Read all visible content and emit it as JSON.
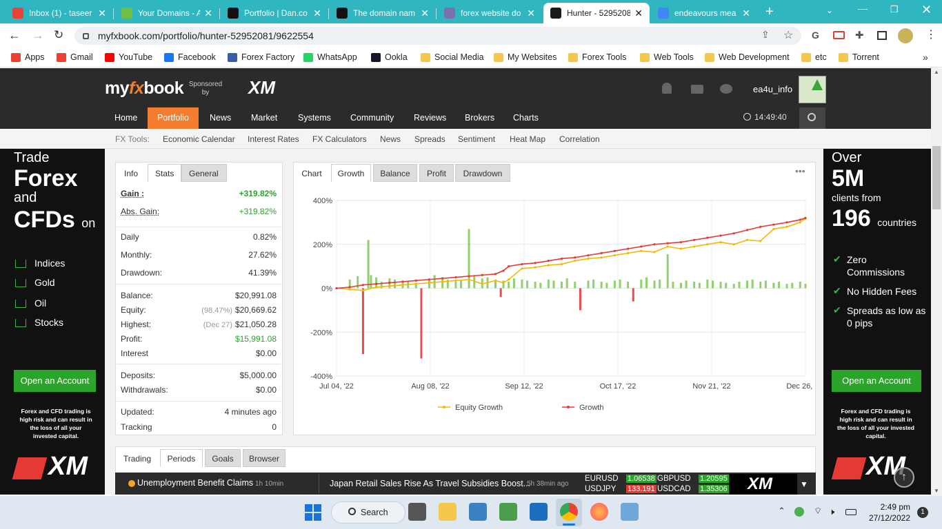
{
  "browser": {
    "tabs": [
      {
        "label": "Inbox (1) - taseer",
        "icon": "gmail-icon",
        "color": "#ea4335"
      },
      {
        "label": "Your Domains - A",
        "icon": "domains-icon",
        "color": "#6fbf44"
      },
      {
        "label": "Portfolio | Dan.co",
        "icon": "dan-icon",
        "color": "#111111"
      },
      {
        "label": "The domain nam",
        "icon": "dan-icon",
        "color": "#111111"
      },
      {
        "label": "forex website do",
        "icon": "page-icon",
        "color": "#7a6fb0"
      },
      {
        "label": "Hunter - 5295208",
        "icon": "fx-icon",
        "color": "#1b1b1b"
      },
      {
        "label": "endeavours mea",
        "icon": "google-icon",
        "color": "#4285f4"
      }
    ],
    "url": "myfxbook.com/portfolio/hunter-52952081/9622554",
    "bookmarks": [
      {
        "label": "Apps",
        "color": "#e94235"
      },
      {
        "label": "Gmail",
        "color": "#ea4335"
      },
      {
        "label": "YouTube",
        "color": "#ff0000"
      },
      {
        "label": "Facebook",
        "color": "#1877f2"
      },
      {
        "label": "Forex Factory",
        "color": "#3a5ca8"
      },
      {
        "label": "WhatsApp",
        "color": "#25d366"
      },
      {
        "label": "Ookla",
        "color": "#141526"
      },
      {
        "label": "Social Media",
        "color": "#f4c84a"
      },
      {
        "label": "My Websites",
        "color": "#f4c84a"
      },
      {
        "label": "Forex Tools",
        "color": "#f4c84a"
      },
      {
        "label": "Web Tools",
        "color": "#f4c84a"
      },
      {
        "label": "Web Development",
        "color": "#f4c84a"
      },
      {
        "label": "etc",
        "color": "#f4c84a"
      },
      {
        "label": "Torrent",
        "color": "#f4c84a"
      }
    ],
    "more": "»"
  },
  "site": {
    "logo_a": "my",
    "logo_b": "fx",
    "logo_c": "book",
    "sponsored": "Sponsored by",
    "sponsor": "XM",
    "username": "ea4u_info",
    "nav": [
      "Home",
      "Portfolio",
      "News",
      "Market",
      "Systems",
      "Community",
      "Reviews",
      "Brokers",
      "Charts"
    ],
    "time": "14:49:40",
    "subnav_label": "FX Tools:",
    "subnav": [
      "Economic Calendar",
      "Interest Rates",
      "FX Calculators",
      "News",
      "Spreads",
      "Sentiment",
      "Heat Map",
      "Correlation"
    ]
  },
  "ad_left": {
    "l1": "Trade",
    "l2": "Forex",
    "l3": "and",
    "l4": "CFDs",
    "l5": "on",
    "items": [
      "Indices",
      "Gold",
      "Oil",
      "Stocks"
    ],
    "cta": "Open an Account",
    "disclaimer": "Forex and CFD trading is high risk and can result in the loss of all your invested capital.",
    "brand": "XM"
  },
  "ad_right": {
    "l1": "Over",
    "l2": "5M",
    "l3": "clients from",
    "l4": "196",
    "l5": "countries",
    "items": [
      "Zero Commissions",
      "No Hidden Fees",
      "Spreads as low as 0 pips"
    ],
    "cta": "Open an Account",
    "disclaimer": "Forex and CFD trading is high risk and can result in the loss of all your invested capital.",
    "brand": "XM"
  },
  "stats": {
    "tabs": [
      "Info",
      "Stats",
      "General"
    ],
    "rows": [
      {
        "k": "Gain :",
        "v": "+319.82%",
        "pre": ""
      },
      {
        "k": "Abs. Gain:",
        "v": "+319.82%",
        "pre": ""
      },
      {
        "k": "Daily",
        "v": "0.82%",
        "pre": ""
      },
      {
        "k": "Monthly:",
        "v": "27.62%",
        "pre": ""
      },
      {
        "k": "Drawdown:",
        "v": "41.39%",
        "pre": ""
      },
      {
        "k": "Balance:",
        "v": "$20,991.08",
        "pre": ""
      },
      {
        "k": "Equity:",
        "v": "$20,669.62",
        "pre": "(98.47%)"
      },
      {
        "k": "Highest:",
        "v": "$21,050.28",
        "pre": "(Dec 27)"
      },
      {
        "k": "Profit:",
        "v": "$15,991.08",
        "pre": ""
      },
      {
        "k": "Interest",
        "v": "$0.00",
        "pre": ""
      },
      {
        "k": "Deposits:",
        "v": "$5,000.00",
        "pre": ""
      },
      {
        "k": "Withdrawals:",
        "v": "$0.00",
        "pre": ""
      },
      {
        "k": "Updated:",
        "v": "4 minutes ago",
        "pre": ""
      },
      {
        "k": "Tracking",
        "v": "0",
        "pre": ""
      }
    ]
  },
  "chart_panel": {
    "tabs": [
      "Chart",
      "Growth",
      "Balance",
      "Profit",
      "Drawdown"
    ],
    "menu": "•••"
  },
  "chart_data": {
    "type": "line",
    "yticks": [
      "400%",
      "200%",
      "0%",
      "-200%",
      "-400%"
    ],
    "xticks": [
      "Jul 04, '22",
      "Aug 08, '22",
      "Sep 12, '22",
      "Oct 17, '22",
      "Nov 21, '22",
      "Dec 26, '22"
    ],
    "ylim": [
      -400,
      400
    ],
    "series": [
      {
        "name": "Equity Growth",
        "color": "#f5b800",
        "x": [
          0,
          5,
          10,
          15,
          20,
          25,
          30,
          35,
          40,
          45,
          50,
          55,
          60,
          63,
          65,
          70,
          75,
          80,
          85,
          90,
          95,
          100,
          105,
          110,
          115,
          120,
          125,
          130,
          135,
          140,
          145,
          150,
          155,
          160,
          165,
          170,
          175,
          177
        ],
        "values": [
          0,
          -5,
          -10,
          5,
          10,
          15,
          20,
          25,
          30,
          35,
          40,
          20,
          35,
          25,
          40,
          90,
          95,
          105,
          110,
          125,
          135,
          140,
          150,
          160,
          170,
          165,
          190,
          180,
          190,
          200,
          210,
          200,
          220,
          215,
          270,
          280,
          300,
          318
        ]
      },
      {
        "name": "Growth",
        "color": "#e53935",
        "x": [
          0,
          5,
          10,
          15,
          20,
          25,
          30,
          35,
          40,
          45,
          50,
          55,
          60,
          63,
          65,
          70,
          75,
          80,
          85,
          90,
          95,
          100,
          105,
          110,
          115,
          120,
          125,
          130,
          135,
          140,
          145,
          150,
          155,
          160,
          165,
          170,
          175,
          177
        ],
        "values": [
          0,
          5,
          15,
          20,
          25,
          30,
          35,
          40,
          45,
          50,
          55,
          60,
          65,
          80,
          100,
          110,
          115,
          125,
          135,
          140,
          150,
          160,
          170,
          180,
          190,
          200,
          205,
          210,
          220,
          230,
          240,
          250,
          265,
          280,
          290,
          300,
          312,
          320
        ]
      }
    ],
    "bars": {
      "x": [
        5,
        8,
        10,
        12,
        13,
        15,
        17,
        20,
        22,
        25,
        27,
        30,
        32,
        35,
        37,
        40,
        42,
        45,
        47,
        50,
        52,
        55,
        57,
        60,
        62,
        63,
        65,
        67,
        70,
        72,
        75,
        77,
        80,
        82,
        85,
        87,
        90,
        92,
        95,
        97,
        100,
        102,
        105,
        107,
        110,
        112,
        115,
        117,
        120,
        122,
        125,
        127,
        130,
        132,
        135,
        137,
        140,
        142,
        145,
        147,
        150,
        152,
        155,
        157,
        160,
        162,
        165,
        167,
        170,
        172,
        175,
        177
      ],
      "values": [
        40,
        55,
        -300,
        220,
        60,
        50,
        30,
        45,
        40,
        35,
        30,
        25,
        -320,
        40,
        60,
        50,
        40,
        30,
        35,
        270,
        60,
        45,
        50,
        40,
        -40,
        35,
        30,
        45,
        40,
        35,
        30,
        25,
        40,
        35,
        30,
        45,
        30,
        -100,
        35,
        40,
        30,
        25,
        35,
        40,
        30,
        -60,
        40,
        50,
        35,
        40,
        155,
        30,
        25,
        35,
        30,
        25,
        40,
        35,
        30,
        25,
        20,
        30,
        35,
        40,
        30,
        35,
        25,
        30,
        20,
        25,
        30,
        20
      ]
    }
  },
  "lower_tabs": [
    "Trading",
    "Periods",
    "Goals",
    "Browser"
  ],
  "ticker": {
    "event": "Unemployment Benefit Claims",
    "event_time": "1h 10min",
    "news": "Japan Retail Sales Rise As Travel Subsidies Boost...",
    "news_time": "5h 38min ago",
    "quotes": [
      {
        "sym": "EURUSD",
        "val": "1.06538",
        "dir": "up"
      },
      {
        "sym": "GBPUSD",
        "val": "1.20595",
        "dir": "up"
      },
      {
        "sym": "USDJPY",
        "val": "133.191",
        "dir": "down"
      },
      {
        "sym": "USDCAD",
        "val": "1.35306",
        "dir": "up"
      }
    ],
    "brand": "XM"
  },
  "taskbar": {
    "search": "Search",
    "time": "2:49 pm",
    "date": "27/12/2022",
    "badge": "1"
  }
}
